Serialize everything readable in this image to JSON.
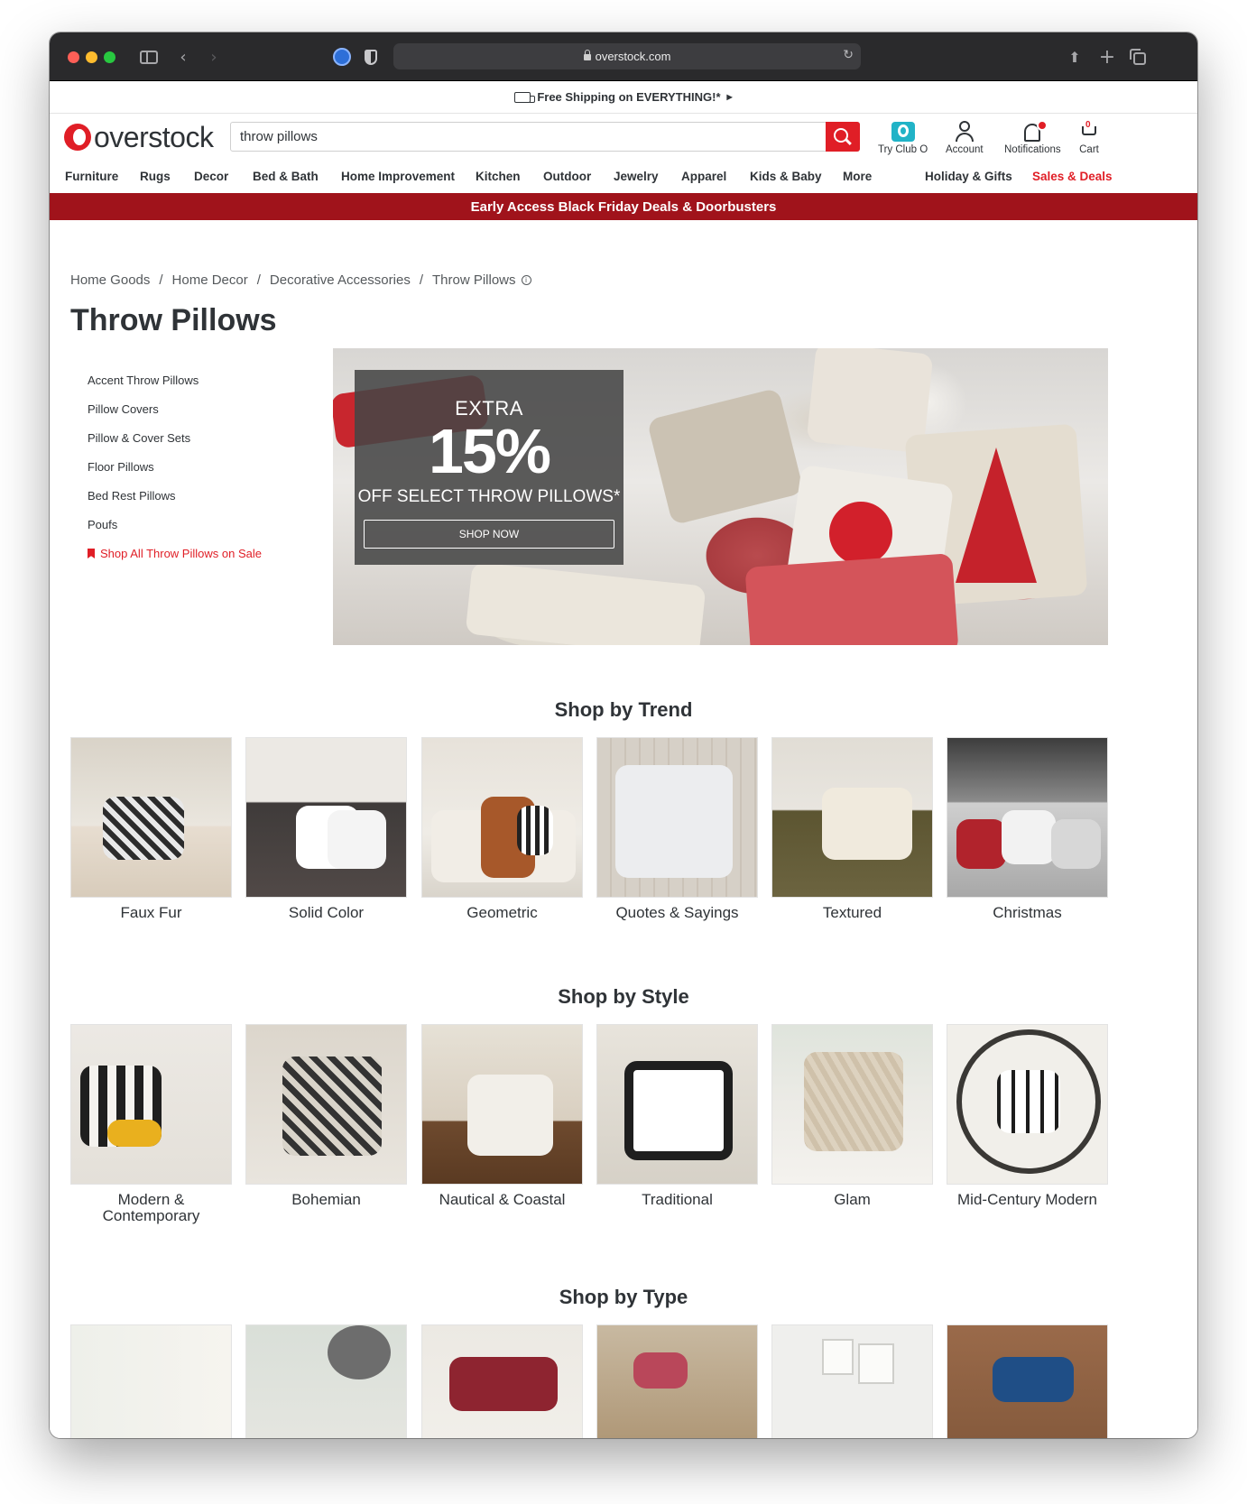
{
  "browser": {
    "url": "overstock.com"
  },
  "promo_bar": {
    "text": "Free Shipping on EVERYTHING!*"
  },
  "header": {
    "logo_text": "overstock",
    "search_value": "throw pillows",
    "club_o": "Try Club O",
    "account": "Account",
    "notifications": "Notifications",
    "cart": "Cart",
    "cart_count": "0"
  },
  "nav": {
    "items": [
      "Furniture",
      "Rugs",
      "Decor",
      "Bed & Bath",
      "Home Improvement",
      "Kitchen",
      "Outdoor",
      "Jewelry",
      "Apparel",
      "Kids & Baby",
      "More"
    ],
    "holiday": "Holiday & Gifts",
    "deals": "Sales & Deals"
  },
  "black_friday_banner": "Early Access Black Friday Deals & Doorbusters",
  "breadcrumb": [
    "Home Goods",
    "Home Decor",
    "Decorative Accessories",
    "Throw Pillows"
  ],
  "page_title": "Throw Pillows",
  "side_links": [
    "Accent Throw Pillows",
    "Pillow Covers",
    "Pillow & Cover Sets",
    "Floor Pillows",
    "Bed Rest Pillows",
    "Poufs"
  ],
  "side_sale_link": "Shop All Throw Pillows on Sale",
  "hero": {
    "extra": "EXTRA",
    "percent": "15%",
    "subtitle": "OFF SELECT THROW PILLOWS*",
    "button": "SHOP NOW"
  },
  "sections": {
    "trend": {
      "title": "Shop by Trend",
      "items": [
        "Faux Fur",
        "Solid Color",
        "Geometric",
        "Quotes & Sayings",
        "Textured",
        "Christmas"
      ]
    },
    "style": {
      "title": "Shop by Style",
      "items": [
        "Modern & Contemporary",
        "Bohemian",
        "Nautical & Coastal",
        "Traditional",
        "Glam",
        "Mid-Century Modern"
      ]
    },
    "type": {
      "title": "Shop by Type"
    }
  },
  "colors": {
    "brand_red": "#e01e26",
    "banner_red": "#a0131b",
    "club_teal": "#21b3c7"
  }
}
